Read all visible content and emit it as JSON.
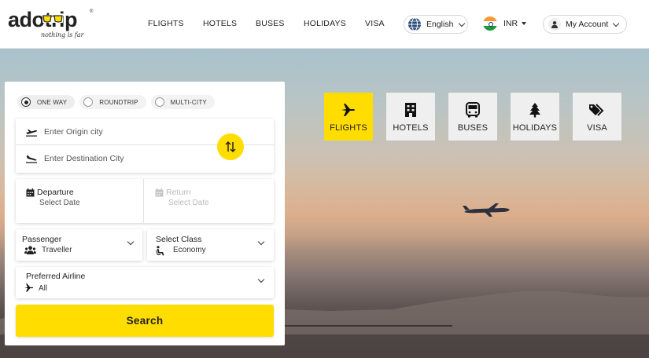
{
  "brand": {
    "name": "adotrip",
    "tagline": "nothing is far",
    "registered": "®",
    "accent": "#ffdd00"
  },
  "nav": {
    "flights": "FLIGHTS",
    "hotels": "HOTELS",
    "buses": "BUSES",
    "holidays": "HOLIDAYS",
    "visa": "VISA"
  },
  "header": {
    "language": "English",
    "currency": "INR",
    "account": "My Account"
  },
  "trip_types": [
    {
      "label": "ONE WAY",
      "selected": true
    },
    {
      "label": "ROUNDTRIP",
      "selected": false
    },
    {
      "label": "MULTI-CITY",
      "selected": false
    }
  ],
  "form": {
    "origin_placeholder": "Enter Origin city",
    "destination_placeholder": "Enter Destination City",
    "departure_label": "Departure",
    "departure_value": "Select Date",
    "return_label": "Return",
    "return_value": "Select Date",
    "passenger_label": "Passenger",
    "passenger_value": "Traveller",
    "class_label": "Select Class",
    "class_value": "Economy",
    "airline_label": "Preferred Airline",
    "airline_value": "All",
    "search_label": "Search"
  },
  "tiles": [
    {
      "label": "FLIGHTS",
      "icon": "plane-icon",
      "active": true
    },
    {
      "label": "HOTELS",
      "icon": "building-icon",
      "active": false
    },
    {
      "label": "BUSES",
      "icon": "bus-icon",
      "active": false
    },
    {
      "label": "HOLIDAYS",
      "icon": "tree-icon",
      "active": false
    },
    {
      "label": "VISA",
      "icon": "tag-icon",
      "active": false
    }
  ]
}
